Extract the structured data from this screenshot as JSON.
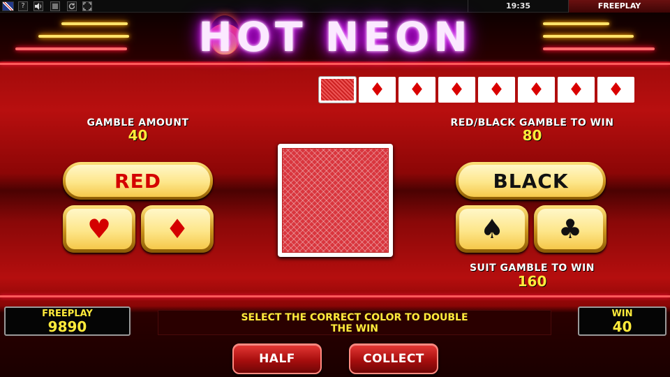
{
  "topbar": {
    "icons": [
      "uk-flag-icon",
      "help-icon",
      "sound-icon",
      "stop-icon",
      "reload-icon",
      "fullscreen-icon"
    ],
    "help_glyph": "?",
    "clock": "19:35",
    "mode": "FREEPLAY"
  },
  "logo": {
    "text": "HOT NEON"
  },
  "history": {
    "cards": [
      "back",
      "diamond",
      "diamond",
      "diamond",
      "diamond",
      "diamond",
      "diamond",
      "diamond"
    ],
    "diamond_glyph": "♦"
  },
  "gamble": {
    "amount_label": "GAMBLE AMOUNT",
    "amount_value": "40",
    "color_win_label": "RED/BLACK GAMBLE TO WIN",
    "color_win_value": "80",
    "suit_win_label": "SUIT GAMBLE TO WIN",
    "suit_win_value": "160"
  },
  "buttons": {
    "red": "RED",
    "black": "BLACK",
    "half": "HALF",
    "collect": "COLLECT"
  },
  "suits": {
    "hearts": "♥",
    "diamonds": "♦",
    "spades": "♠",
    "clubs": "♣"
  },
  "panels": {
    "balance_label": "FREEPLAY",
    "balance_value": "9890",
    "win_label": "WIN",
    "win_value": "40"
  },
  "message": {
    "line1": "SELECT THE CORRECT COLOR TO DOUBLE",
    "line2": "THE WIN"
  },
  "colors": {
    "accent_yellow": "#ffeb3b",
    "red_text": "#d40000",
    "black_text": "#111111",
    "neon_purple": "#e040fb"
  }
}
